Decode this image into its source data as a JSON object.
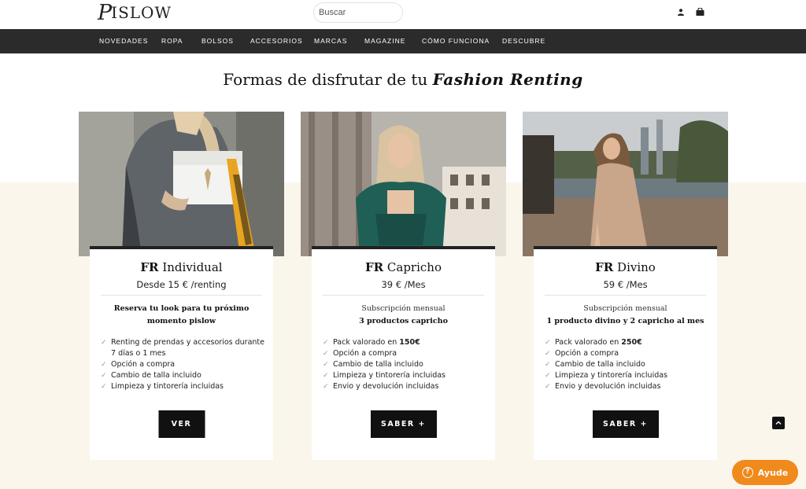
{
  "header": {
    "logo_text": "PISLOW",
    "logo_glyph": "P",
    "logo_rest": "ISLOW",
    "search_placeholder": "Buscar"
  },
  "nav": {
    "items": [
      "NOVEDADES",
      "ROPA",
      "BOLSOS",
      "ACCESORIOS",
      "MARCAS",
      "MAGAZINE",
      "CÓMO FUNCIONA",
      "DESCUBRE"
    ]
  },
  "page": {
    "title_plain": "Formas de disfrutar de tu ",
    "title_em": "Fashion Renting"
  },
  "plans": [
    {
      "name_prefix": "FR",
      "name_rest": "Individual",
      "price": "Desde 15 € /renting",
      "sub1": "Reserva tu look para tu próximo",
      "sub2": "momento pislow",
      "features": [
        "Renting de prendas y accesorios durante",
        "7 días o 1 mes",
        "Opción a compra",
        "Cambio de talla incluido",
        "Limpieza y tintorería incluidas"
      ],
      "button_label": "VER"
    },
    {
      "name_prefix": "FR",
      "name_rest": "Capricho",
      "price": "39 € /Mes",
      "sub1": "Subscripción mensual",
      "sub2": "3 productos capricho",
      "features_first_prefix": "Pack valorado en ",
      "features_first_bold": "150€",
      "features": [
        "Opción a compra",
        "Cambio de talla incluido",
        "Limpieza y tintorería incluidas",
        "Envio y devolución incluidas"
      ],
      "button_label": "SABER +"
    },
    {
      "name_prefix": "FR",
      "name_rest": "Divino",
      "price": "59 € /Mes",
      "sub1": "Subscripción mensual",
      "sub2": "1 producto divino y 2 capricho al mes",
      "features_first_prefix": "Pack valorado en ",
      "features_first_bold": "250€",
      "features": [
        "Opción a compra",
        "Cambio de talla incluido",
        "Limpieza y tintorería incluidas",
        "Envio y devolución incluidas"
      ],
      "button_label": "SABER +"
    }
  ],
  "help": {
    "label": "Ayude",
    "icon": "question-icon"
  },
  "icons": {
    "user": "user-icon",
    "cart": "shopping-bag-icon",
    "check": "checkmark-icon",
    "scroll_top": "chevron-up-icon"
  },
  "colors": {
    "nav_bg": "#2b2b2b",
    "cream_bg": "#fbf6ec",
    "button_bg": "#111111",
    "help_bg": "#f08a1c"
  }
}
